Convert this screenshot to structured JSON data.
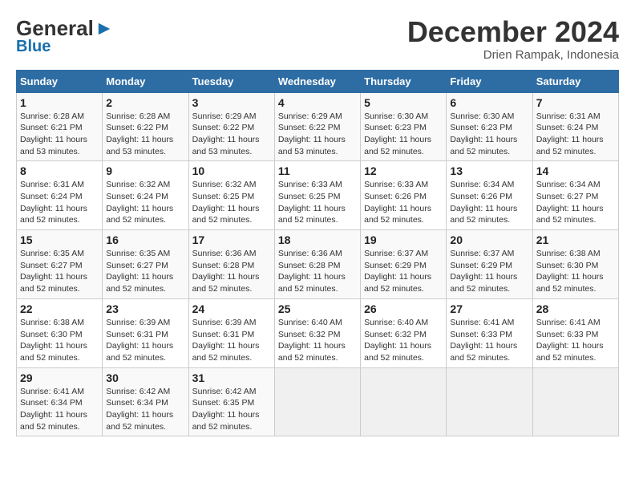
{
  "header": {
    "logo_general": "General",
    "logo_blue": "Blue",
    "month_title": "December 2024",
    "location": "Drien Rampak, Indonesia"
  },
  "days_of_week": [
    "Sunday",
    "Monday",
    "Tuesday",
    "Wednesday",
    "Thursday",
    "Friday",
    "Saturday"
  ],
  "weeks": [
    [
      {
        "day": "1",
        "sunrise": "6:28 AM",
        "sunset": "6:21 PM",
        "daylight": "11 hours and 53 minutes."
      },
      {
        "day": "2",
        "sunrise": "6:28 AM",
        "sunset": "6:22 PM",
        "daylight": "11 hours and 53 minutes."
      },
      {
        "day": "3",
        "sunrise": "6:29 AM",
        "sunset": "6:22 PM",
        "daylight": "11 hours and 53 minutes."
      },
      {
        "day": "4",
        "sunrise": "6:29 AM",
        "sunset": "6:22 PM",
        "daylight": "11 hours and 53 minutes."
      },
      {
        "day": "5",
        "sunrise": "6:30 AM",
        "sunset": "6:23 PM",
        "daylight": "11 hours and 52 minutes."
      },
      {
        "day": "6",
        "sunrise": "6:30 AM",
        "sunset": "6:23 PM",
        "daylight": "11 hours and 52 minutes."
      },
      {
        "day": "7",
        "sunrise": "6:31 AM",
        "sunset": "6:24 PM",
        "daylight": "11 hours and 52 minutes."
      }
    ],
    [
      {
        "day": "8",
        "sunrise": "6:31 AM",
        "sunset": "6:24 PM",
        "daylight": "11 hours and 52 minutes."
      },
      {
        "day": "9",
        "sunrise": "6:32 AM",
        "sunset": "6:24 PM",
        "daylight": "11 hours and 52 minutes."
      },
      {
        "day": "10",
        "sunrise": "6:32 AM",
        "sunset": "6:25 PM",
        "daylight": "11 hours and 52 minutes."
      },
      {
        "day": "11",
        "sunrise": "6:33 AM",
        "sunset": "6:25 PM",
        "daylight": "11 hours and 52 minutes."
      },
      {
        "day": "12",
        "sunrise": "6:33 AM",
        "sunset": "6:26 PM",
        "daylight": "11 hours and 52 minutes."
      },
      {
        "day": "13",
        "sunrise": "6:34 AM",
        "sunset": "6:26 PM",
        "daylight": "11 hours and 52 minutes."
      },
      {
        "day": "14",
        "sunrise": "6:34 AM",
        "sunset": "6:27 PM",
        "daylight": "11 hours and 52 minutes."
      }
    ],
    [
      {
        "day": "15",
        "sunrise": "6:35 AM",
        "sunset": "6:27 PM",
        "daylight": "11 hours and 52 minutes."
      },
      {
        "day": "16",
        "sunrise": "6:35 AM",
        "sunset": "6:27 PM",
        "daylight": "11 hours and 52 minutes."
      },
      {
        "day": "17",
        "sunrise": "6:36 AM",
        "sunset": "6:28 PM",
        "daylight": "11 hours and 52 minutes."
      },
      {
        "day": "18",
        "sunrise": "6:36 AM",
        "sunset": "6:28 PM",
        "daylight": "11 hours and 52 minutes."
      },
      {
        "day": "19",
        "sunrise": "6:37 AM",
        "sunset": "6:29 PM",
        "daylight": "11 hours and 52 minutes."
      },
      {
        "day": "20",
        "sunrise": "6:37 AM",
        "sunset": "6:29 PM",
        "daylight": "11 hours and 52 minutes."
      },
      {
        "day": "21",
        "sunrise": "6:38 AM",
        "sunset": "6:30 PM",
        "daylight": "11 hours and 52 minutes."
      }
    ],
    [
      {
        "day": "22",
        "sunrise": "6:38 AM",
        "sunset": "6:30 PM",
        "daylight": "11 hours and 52 minutes."
      },
      {
        "day": "23",
        "sunrise": "6:39 AM",
        "sunset": "6:31 PM",
        "daylight": "11 hours and 52 minutes."
      },
      {
        "day": "24",
        "sunrise": "6:39 AM",
        "sunset": "6:31 PM",
        "daylight": "11 hours and 52 minutes."
      },
      {
        "day": "25",
        "sunrise": "6:40 AM",
        "sunset": "6:32 PM",
        "daylight": "11 hours and 52 minutes."
      },
      {
        "day": "26",
        "sunrise": "6:40 AM",
        "sunset": "6:32 PM",
        "daylight": "11 hours and 52 minutes."
      },
      {
        "day": "27",
        "sunrise": "6:41 AM",
        "sunset": "6:33 PM",
        "daylight": "11 hours and 52 minutes."
      },
      {
        "day": "28",
        "sunrise": "6:41 AM",
        "sunset": "6:33 PM",
        "daylight": "11 hours and 52 minutes."
      }
    ],
    [
      {
        "day": "29",
        "sunrise": "6:41 AM",
        "sunset": "6:34 PM",
        "daylight": "11 hours and 52 minutes."
      },
      {
        "day": "30",
        "sunrise": "6:42 AM",
        "sunset": "6:34 PM",
        "daylight": "11 hours and 52 minutes."
      },
      {
        "day": "31",
        "sunrise": "6:42 AM",
        "sunset": "6:35 PM",
        "daylight": "11 hours and 52 minutes."
      },
      null,
      null,
      null,
      null
    ]
  ],
  "labels": {
    "sunrise": "Sunrise:",
    "sunset": "Sunset:",
    "daylight": "Daylight:"
  }
}
